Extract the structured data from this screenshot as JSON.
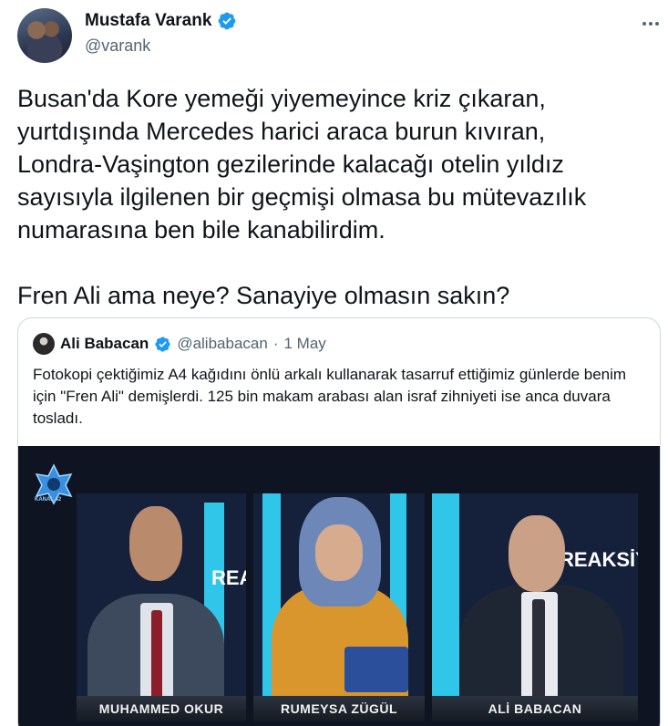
{
  "tweet": {
    "author_name": "Mustafa Varank",
    "author_handle": "@varank",
    "avatar_icon": "user-avatar",
    "verified_icon": "verified-badge-icon",
    "more_icon": "more-options-icon",
    "text": "Busan'da Kore yemeği yiyemeyince kriz çıkaran,\nyurtdışında Mercedes harici araca burun kıvıran,\nLondra-Vaşington gezilerinde kalacağı otelin yıldız\nsayısıyla ilgilenen bir geçmişi olmasa bu mütevazılık\nnumarasına ben bile kanabilirdim.\n\nFren Ali ama neye? Sanayiye olmasın sakın?"
  },
  "quoted_tweet": {
    "author_name": "Ali Babacan",
    "author_handle": "@alibabacan",
    "separator": "·",
    "date": "1 May",
    "text": "Fotokopi çektiğimiz A4 kağıdını önlü arkalı kullanarak tasarruf ettiğimiz günlerde benim için \"Fren Ali\" demişlerdi. 125 bin makam arabası alan israf zihniyeti ise anca duvara tosladı.",
    "media": {
      "channel_logo": "KANAL 42",
      "backdrop_words": [
        "REA",
        "REAKSİYO"
      ],
      "lower_thirds": [
        "MUHAMMED OKUR",
        "RUMEYSA ZÜGÜL",
        "ALİ BABACAN"
      ]
    }
  },
  "colors": {
    "text_primary": "#0f1419",
    "text_secondary": "#536471",
    "verified_blue": "#1d9bf0",
    "border": "#cfd9de",
    "studio_cyan": "#2fc6e9"
  }
}
